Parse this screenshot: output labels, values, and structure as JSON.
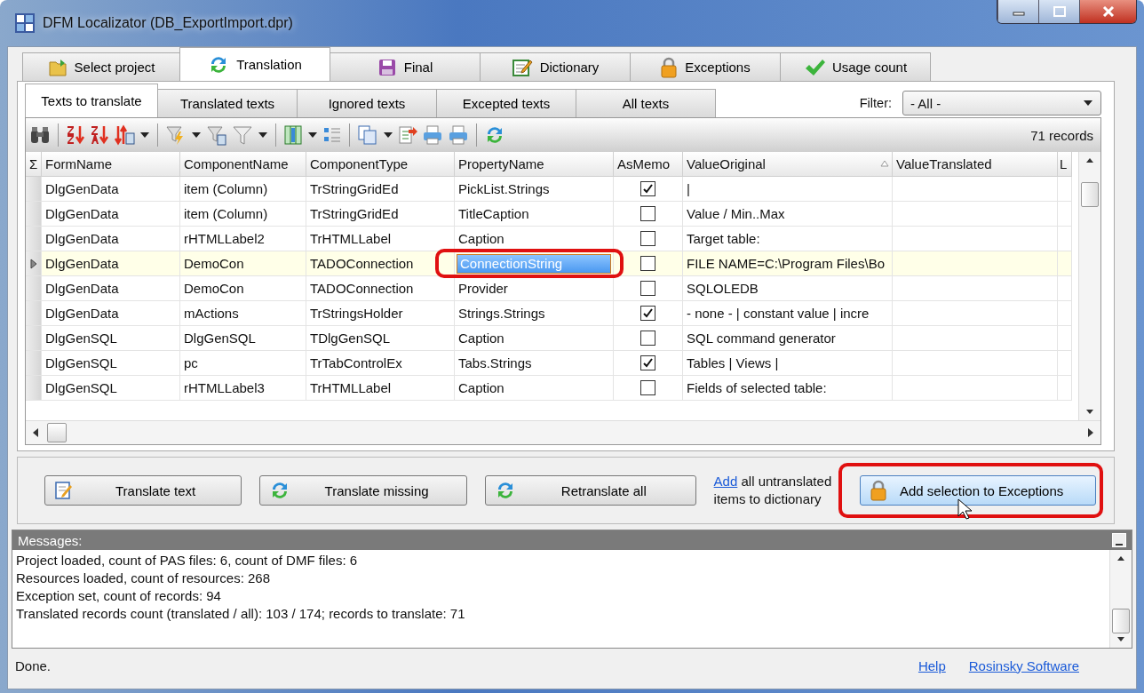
{
  "window": {
    "title": "DFM Localizator  (DB_ExportImport.dpr)"
  },
  "tabs": [
    {
      "label": "Select project",
      "selected": false
    },
    {
      "label": "Translation",
      "selected": true
    },
    {
      "label": "Final",
      "selected": false
    },
    {
      "label": "Dictionary",
      "selected": false
    },
    {
      "label": "Exceptions",
      "selected": false
    },
    {
      "label": "Usage count",
      "selected": false
    }
  ],
  "subtabs": [
    {
      "label": "Texts to translate",
      "selected": true
    },
    {
      "label": "Translated texts",
      "selected": false
    },
    {
      "label": "Ignored texts",
      "selected": false
    },
    {
      "label": "Excepted texts",
      "selected": false
    },
    {
      "label": "All texts",
      "selected": false
    }
  ],
  "filter": {
    "label": "Filter:",
    "value": "- All -"
  },
  "toolbar": {
    "records": "71 records"
  },
  "table": {
    "indicator_header": "Σ",
    "columns": [
      {
        "label": "FormName",
        "sorted": false
      },
      {
        "label": "ComponentName",
        "sorted": false
      },
      {
        "label": "ComponentType",
        "sorted": false
      },
      {
        "label": "PropertyName",
        "sorted": false
      },
      {
        "label": "AsMemo",
        "sorted": false
      },
      {
        "label": "ValueOriginal",
        "sorted": true
      },
      {
        "label": "ValueTranslated",
        "sorted": false
      },
      {
        "label": "L",
        "sorted": false
      }
    ],
    "rows": [
      {
        "cells": [
          "DlgGenData",
          "item (Column)",
          "TrStringGridEd",
          "PickList.Strings"
        ],
        "as_memo": true,
        "value": "|",
        "selected": false
      },
      {
        "cells": [
          "DlgGenData",
          "item (Column)",
          "TrStringGridEd",
          "TitleCaption"
        ],
        "as_memo": false,
        "value": "Value / Min..Max",
        "selected": false
      },
      {
        "cells": [
          "DlgGenData",
          "rHTMLLabel2",
          "TrHTMLLabel",
          "Caption"
        ],
        "as_memo": false,
        "value": "Target table:",
        "selected": false
      },
      {
        "cells": [
          "DlgGenData",
          "DemoCon",
          "TADOConnection",
          "ConnectionString"
        ],
        "as_memo": false,
        "value": "FILE NAME=C:\\Program Files\\Bo",
        "selected": true
      },
      {
        "cells": [
          "DlgGenData",
          "DemoCon",
          "TADOConnection",
          "Provider"
        ],
        "as_memo": false,
        "value": "SQLOLEDB",
        "selected": false
      },
      {
        "cells": [
          "DlgGenData",
          "mActions",
          "TrStringsHolder",
          "Strings.Strings"
        ],
        "as_memo": true,
        "value": "- none - | constant value | incre",
        "selected": false
      },
      {
        "cells": [
          "DlgGenSQL",
          "DlgGenSQL",
          "TDlgGenSQL",
          "Caption"
        ],
        "as_memo": false,
        "value": "SQL command generator",
        "selected": false
      },
      {
        "cells": [
          "DlgGenSQL",
          "pc",
          "TrTabControlEx",
          "Tabs.Strings"
        ],
        "as_memo": true,
        "value": "Tables | Views |",
        "selected": false
      },
      {
        "cells": [
          "DlgGenSQL",
          "rHTMLLabel3",
          "TrHTMLLabel",
          "Caption"
        ],
        "as_memo": false,
        "value": "Fields of selected table:",
        "selected": false
      }
    ]
  },
  "actions": {
    "buttons": [
      "Translate text",
      "Translate missing",
      "Retranslate all"
    ],
    "link": "Add",
    "note": "all untranslated items to dictionary",
    "exceptions_button": {
      "label": "Add selection to Exceptions",
      "highlighted": true
    }
  },
  "messages": {
    "title": "Messages:",
    "lines": [
      "Project loaded, count of PAS files: 6, count of DMF files: 6",
      "Resources loaded, count of resources: 268",
      "Exception set, count of records: 94",
      "Translated records count (translated / all): 103 / 174;  records to translate: 71"
    ]
  },
  "status_bar": {
    "text": "Done.",
    "links": [
      "Help",
      "Rosinsky Software"
    ]
  }
}
